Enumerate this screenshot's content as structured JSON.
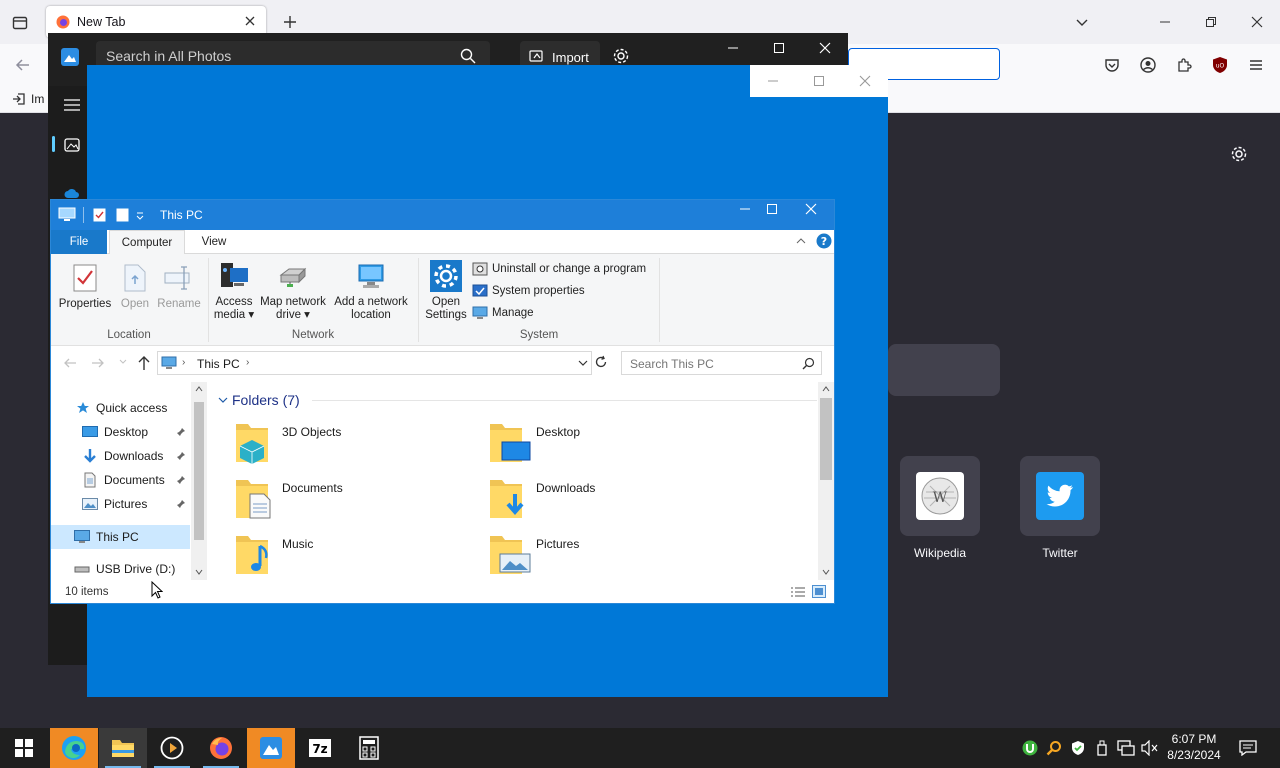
{
  "firefox": {
    "tab_title": "New Tab",
    "bookmark_import_label": "Im",
    "shortcuts": [
      {
        "label": "Wikipedia",
        "icon": "wikipedia-icon"
      },
      {
        "label": "Twitter",
        "icon": "twitter-icon"
      }
    ]
  },
  "photos": {
    "search_placeholder": "Search in All Photos",
    "import_label": "Import"
  },
  "explorer": {
    "title": "This PC",
    "tabs": [
      "File",
      "Computer",
      "View"
    ],
    "ribbon": {
      "location": {
        "label": "Location",
        "buttons": [
          {
            "label": "Properties",
            "enabled": true
          },
          {
            "label": "Open",
            "enabled": false
          },
          {
            "label": "Rename",
            "enabled": false
          }
        ]
      },
      "network": {
        "label": "Network",
        "buttons": [
          {
            "line1": "Access",
            "line2": "media ▾"
          },
          {
            "line1": "Map network",
            "line2": "drive ▾"
          },
          {
            "line1": "Add a network",
            "line2": "location"
          }
        ]
      },
      "system": {
        "label": "System",
        "open_settings_line1": "Open",
        "open_settings_line2": "Settings",
        "items": [
          "Uninstall or change a program",
          "System properties",
          "Manage"
        ]
      }
    },
    "address": "This PC",
    "search_placeholder": "Search This PC",
    "nav_tree": [
      {
        "label": "Quick access",
        "icon": "star-icon"
      },
      {
        "label": "Desktop",
        "icon": "desktop-icon",
        "pinned": true
      },
      {
        "label": "Downloads",
        "icon": "download-arrow-icon",
        "pinned": true
      },
      {
        "label": "Documents",
        "icon": "document-icon",
        "pinned": true
      },
      {
        "label": "Pictures",
        "icon": "picture-icon",
        "pinned": true
      },
      {
        "label": "This PC",
        "icon": "computer-icon",
        "selected": true
      },
      {
        "label": "USB Drive (D:)",
        "icon": "usb-drive-icon"
      }
    ],
    "folders_header": "Folders (7)",
    "folders": [
      "3D Objects",
      "Desktop",
      "Documents",
      "Downloads",
      "Music",
      "Pictures"
    ],
    "status": "10 items"
  },
  "taskbar": {
    "apps": [
      "start",
      "edge",
      "file-explorer",
      "media-player",
      "firefox",
      "photos",
      "7-zip",
      "calculator"
    ],
    "time": "6:07 PM",
    "date": "8/23/2024"
  },
  "colors": {
    "explorer_accent": "#1979ca",
    "blue_window": "#0078d7",
    "firefox_dark": "#2b2a33"
  }
}
